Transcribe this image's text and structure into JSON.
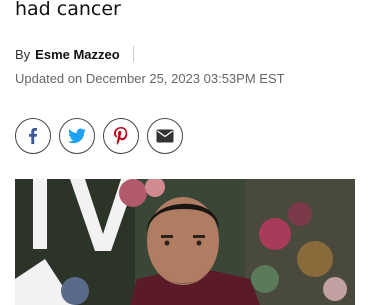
{
  "article": {
    "headline_tail": "had cancer",
    "byline_prefix": "By",
    "author": "Esme Mazzeo",
    "updated": "Updated on December 25, 2023 03:53PM EST"
  },
  "share": {
    "buttons": [
      {
        "icon": "facebook-icon",
        "color": "#3b5998"
      },
      {
        "icon": "twitter-icon",
        "color": "#1da1f2"
      },
      {
        "icon": "pinterest-icon",
        "color": "#bd081c"
      },
      {
        "icon": "email-icon",
        "color": "#333333"
      }
    ]
  },
  "colors": {
    "text": "#111111",
    "muted": "#666666",
    "border": "#444444"
  }
}
